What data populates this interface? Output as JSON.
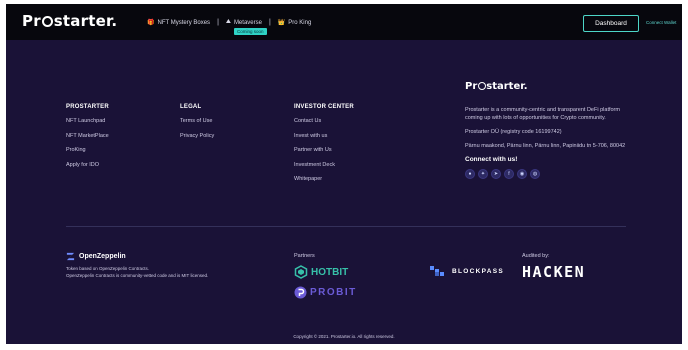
{
  "header": {
    "logo_prefix": "Pr",
    "logo_suffix": "starter.",
    "nav": [
      {
        "icon": "🎁",
        "label": "NFT Mystery Boxes"
      },
      {
        "icon": "⛰",
        "label": "Metaverse"
      },
      {
        "icon": "👑",
        "label": "Pro King"
      }
    ],
    "metaverse_badge": "Coming soon",
    "dashboard_label": "Dashboard",
    "connect_wallet_label": "Connect Wallet"
  },
  "footer": {
    "columns": [
      {
        "title": "PROSTARTER",
        "links": [
          "NFT Launchpad",
          "NFT MarketPlace",
          "ProKing",
          "Apply for IDO"
        ]
      },
      {
        "title": "LEGAL",
        "links": [
          "Terms of Use",
          "Privacy Policy"
        ]
      },
      {
        "title": "INVESTOR CENTER",
        "links": [
          "Contact Us",
          "Invest with us",
          "Partner with Us",
          "Investment Deck",
          "Whitepaper"
        ]
      }
    ],
    "about": {
      "logo_prefix": "Pr",
      "logo_suffix": "starter.",
      "description": "Prostarter is a community-centric and transparent DeFi platform coming up with lots of opportunities for Crypto community.",
      "company": "Prostarter OÜ (registry code 16199742)",
      "address": "Pärnu maakond, Pärnu linn, Pärnu linn, Papiniidu tn 5-706, 80042",
      "connect_title": "Connect with us!",
      "socials": [
        "medium-icon",
        "twitter-icon",
        "telegram-icon",
        "facebook-icon",
        "reddit-icon",
        "discord-icon"
      ]
    },
    "openzeppelin": {
      "brand": "OpenZeppelin",
      "line1": "Token based on OpenZeppelin Contracts.",
      "line2": "OpenZeppelin Contracts is community-vetted code and is MIT licensed."
    },
    "partners_label": "Partners",
    "partners": [
      "HOTBIT",
      "PROBIT"
    ],
    "blockpass": "BLOCKPASS",
    "audited_label": "Audited by:",
    "auditor": "HACKEN",
    "copyright": "Copyright © 2021. Prostarter.io. All rights reserved."
  },
  "colors": {
    "background": "#1a1237",
    "header": "#07070d",
    "accent": "#4dd6c8"
  }
}
